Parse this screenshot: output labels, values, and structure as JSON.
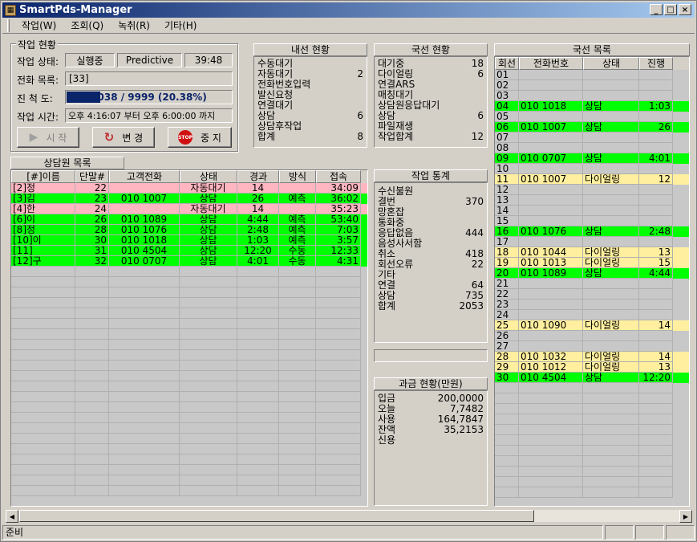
{
  "window": {
    "title": "SmartPds-Manager",
    "app_icon": "pds-app-icon",
    "minimize": "_",
    "maximize": "□",
    "close": "×"
  },
  "menu": [
    {
      "label": "작업(W)"
    },
    {
      "label": "조회(Q)"
    },
    {
      "label": "녹취(R)"
    },
    {
      "label": "기타(H)"
    }
  ],
  "job": {
    "group_label": "작업 현황",
    "state_label": "작업 상태:",
    "state_value": "실행중",
    "mode_value": "Predictive",
    "elapsed": "39:48",
    "list_label": "전화 목록:",
    "list_value": "[33]",
    "progress_label": "진 척 도:",
    "progress_text": "2038 / 9999 (20.38%)",
    "progress_fraction": 0.2038,
    "time_label": "작업 시간:",
    "time_value": "오후  4:16:07 부터 오후  6:00:00 까지",
    "start_label": "시 작",
    "change_label": "변 경",
    "stop_label": "중 지",
    "stop_icon_text": "STOP"
  },
  "internal": {
    "title": "내선 현황",
    "rows": [
      {
        "k": "수동대기",
        "v": ""
      },
      {
        "k": "자동대기",
        "v": "2"
      },
      {
        "k": "전화번호입력",
        "v": ""
      },
      {
        "k": "발신요청",
        "v": ""
      },
      {
        "k": "연결대기",
        "v": ""
      },
      {
        "k": "상담",
        "v": "6"
      },
      {
        "k": "상담후작업",
        "v": ""
      },
      {
        "k": "합계",
        "v": "8"
      }
    ]
  },
  "trunk": {
    "title": "국선 현황",
    "rows": [
      {
        "k": "대기중",
        "v": "18"
      },
      {
        "k": "다이얼링",
        "v": "6"
      },
      {
        "k": "연결ARS",
        "v": ""
      },
      {
        "k": "매칭대기",
        "v": ""
      },
      {
        "k": "상담원응답대기",
        "v": ""
      },
      {
        "k": "상담",
        "v": "6"
      },
      {
        "k": "파일재생",
        "v": ""
      },
      {
        "k": "작업합계",
        "v": "12"
      }
    ]
  },
  "stats": {
    "title": "작업 통계",
    "rows": [
      {
        "k": "수신불원",
        "v": ""
      },
      {
        "k": "결번",
        "v": "370"
      },
      {
        "k": "망혼잡",
        "v": ""
      },
      {
        "k": "통화중",
        "v": ""
      },
      {
        "k": "응답없음",
        "v": "444"
      },
      {
        "k": "음성사서함",
        "v": ""
      },
      {
        "k": "취소",
        "v": "418"
      },
      {
        "k": "회선오류",
        "v": "22"
      },
      {
        "k": "기타",
        "v": ""
      },
      {
        "k": "연결",
        "v": "64"
      },
      {
        "k": "상담",
        "v": "735"
      },
      {
        "k": "합계",
        "v": "2053"
      }
    ]
  },
  "billing": {
    "title": "과금 현황(만원)",
    "rows": [
      {
        "k": "입금",
        "v": "200,0000"
      },
      {
        "k": "오늘",
        "v": "7,7482"
      },
      {
        "k": "사용",
        "v": "164,7847"
      },
      {
        "k": "잔액",
        "v": "35,2153"
      },
      {
        "k": "신용",
        "v": ""
      }
    ]
  },
  "agents": {
    "title": "상담원 목록",
    "headers": [
      "[#]이름",
      "단말#",
      "고객전화",
      "상태",
      "경과",
      "방식",
      "접속"
    ],
    "rows": [
      {
        "c": "pink",
        "cells": [
          "[2]정",
          "22",
          "",
          "자동대기",
          "14",
          "",
          "34:09"
        ]
      },
      {
        "c": "green",
        "cells": [
          "[3]김",
          "23",
          "010  1007",
          "상담",
          "26",
          "예측",
          "36:02"
        ]
      },
      {
        "c": "pink",
        "cells": [
          "[4]한",
          "24",
          "",
          "자동대기",
          "14",
          "",
          "35:23"
        ]
      },
      {
        "c": "green",
        "cells": [
          "[6]이",
          "26",
          "010  1089",
          "상담",
          "4:44",
          "예측",
          "53:40"
        ]
      },
      {
        "c": "green",
        "cells": [
          "[8]정",
          "28",
          "010  1076",
          "상담",
          "2:48",
          "예측",
          "7:03"
        ]
      },
      {
        "c": "green",
        "cells": [
          "[10]이",
          "30",
          "010  1018",
          "상담",
          "1:03",
          "예측",
          "3:57"
        ]
      },
      {
        "c": "green",
        "cells": [
          "[11]",
          "31",
          "010  4504",
          "상담",
          "12:20",
          "수동",
          "12:33"
        ]
      },
      {
        "c": "green",
        "cells": [
          "[12]구",
          "32",
          "010  0707",
          "상담",
          "4:01",
          "수동",
          "4:31"
        ]
      }
    ]
  },
  "lines": {
    "title": "국선 목록",
    "headers": [
      "회선",
      "전화번호",
      "상태",
      "진행"
    ],
    "rows": [
      {
        "c": "",
        "cells": [
          "01",
          "",
          "",
          ""
        ]
      },
      {
        "c": "",
        "cells": [
          "02",
          "",
          "",
          ""
        ]
      },
      {
        "c": "",
        "cells": [
          "03",
          "",
          "",
          ""
        ]
      },
      {
        "c": "green",
        "cells": [
          "04",
          "010    1018",
          "상담",
          "1:03"
        ]
      },
      {
        "c": "",
        "cells": [
          "05",
          "",
          "",
          ""
        ]
      },
      {
        "c": "green",
        "cells": [
          "06",
          "010    1007",
          "상담",
          "26"
        ]
      },
      {
        "c": "",
        "cells": [
          "07",
          "",
          "",
          ""
        ]
      },
      {
        "c": "",
        "cells": [
          "08",
          "",
          "",
          ""
        ]
      },
      {
        "c": "green",
        "cells": [
          "09",
          "010    0707",
          "상담",
          "4:01"
        ]
      },
      {
        "c": "",
        "cells": [
          "10",
          "",
          "",
          ""
        ]
      },
      {
        "c": "yellow",
        "cells": [
          "11",
          "010    1007",
          "다이얼링",
          "12"
        ]
      },
      {
        "c": "",
        "cells": [
          "12",
          "",
          "",
          ""
        ]
      },
      {
        "c": "",
        "cells": [
          "13",
          "",
          "",
          ""
        ]
      },
      {
        "c": "",
        "cells": [
          "14",
          "",
          "",
          ""
        ]
      },
      {
        "c": "",
        "cells": [
          "15",
          "",
          "",
          ""
        ]
      },
      {
        "c": "green",
        "cells": [
          "16",
          "010    1076",
          "상담",
          "2:48"
        ]
      },
      {
        "c": "",
        "cells": [
          "17",
          "",
          "",
          ""
        ]
      },
      {
        "c": "yellow",
        "cells": [
          "18",
          "010    1044",
          "다이얼링",
          "13"
        ]
      },
      {
        "c": "yellow",
        "cells": [
          "19",
          "010    1013",
          "다이얼링",
          "15"
        ]
      },
      {
        "c": "green",
        "cells": [
          "20",
          "010    1089",
          "상담",
          "4:44"
        ]
      },
      {
        "c": "",
        "cells": [
          "21",
          "",
          "",
          ""
        ]
      },
      {
        "c": "",
        "cells": [
          "22",
          "",
          "",
          ""
        ]
      },
      {
        "c": "",
        "cells": [
          "23",
          "",
          "",
          ""
        ]
      },
      {
        "c": "",
        "cells": [
          "24",
          "",
          "",
          ""
        ]
      },
      {
        "c": "yellow",
        "cells": [
          "25",
          "010    1090",
          "다이얼링",
          "14"
        ]
      },
      {
        "c": "",
        "cells": [
          "26",
          "",
          "",
          ""
        ]
      },
      {
        "c": "",
        "cells": [
          "27",
          "",
          "",
          ""
        ]
      },
      {
        "c": "yellow",
        "cells": [
          "28",
          "010    1032",
          "다이얼링",
          "14"
        ]
      },
      {
        "c": "yellow",
        "cells": [
          "29",
          "010    1012",
          "다이얼링",
          "13"
        ]
      },
      {
        "c": "green",
        "cells": [
          "30",
          "010    4504",
          "상담",
          "12:20"
        ]
      }
    ]
  },
  "status": {
    "text": "준비"
  },
  "colors": {
    "pink": "#ffb6c1",
    "green": "#00ff00",
    "yellow": "#ffef9e",
    "title_bar": "#0a246a"
  }
}
